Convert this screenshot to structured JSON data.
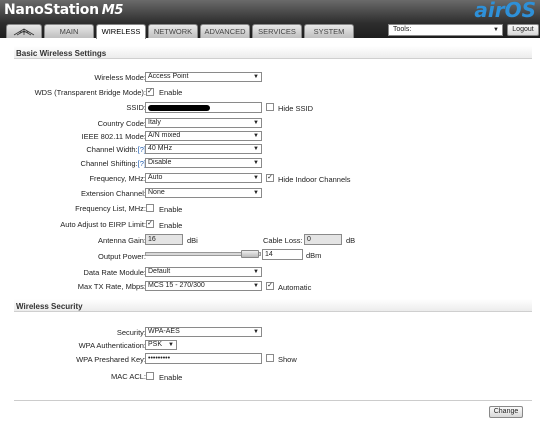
{
  "brand": {
    "name": "NanoStation",
    "model": "M5",
    "os_logo": "airOS"
  },
  "tabs": [
    {
      "icon": "ubnt-logo-icon"
    },
    {
      "label": "MAIN"
    },
    {
      "label": "WIRELESS"
    },
    {
      "label": "NETWORK"
    },
    {
      "label": "ADVANCED"
    },
    {
      "label": "SERVICES"
    },
    {
      "label": "SYSTEM"
    }
  ],
  "tools": {
    "label": "Tools:"
  },
  "logout_label": "Logout",
  "basic": {
    "title": "Basic Wireless Settings",
    "wireless_mode": {
      "label": "Wireless Mode:",
      "value": "Access Point"
    },
    "wds": {
      "label": "WDS (Transparent Bridge Mode):",
      "option": "Enable",
      "checked": true
    },
    "ssid": {
      "label": "SSID:",
      "hide_label": "Hide SSID"
    },
    "country": {
      "label": "Country Code:",
      "value": "Italy"
    },
    "ieee": {
      "label": "IEEE 802.11 Mode:",
      "value": "A/N mixed"
    },
    "channel_width": {
      "label": "Channel Width:",
      "help": "[?]",
      "value": "40 MHz"
    },
    "channel_shifting": {
      "label": "Channel Shifting:",
      "help": "[?]",
      "value": "Disable"
    },
    "frequency": {
      "label": "Frequency, MHz:",
      "value": "Auto",
      "hide_indoor": "Hide Indoor Channels",
      "hide_indoor_checked": true
    },
    "extension": {
      "label": "Extension Channel:",
      "value": "None"
    },
    "freq_list": {
      "label": "Frequency List, MHz:",
      "option": "Enable"
    },
    "auto_eirp": {
      "label": "Auto Adjust to EIRP Limit:",
      "option": "Enable",
      "checked": true
    },
    "antenna_gain": {
      "label": "Antenna Gain:",
      "value": "16",
      "unit": "dBi"
    },
    "cable_loss": {
      "label": "Cable Loss:",
      "value": "0",
      "unit": "dB"
    },
    "output_power": {
      "label": "Output Power:",
      "value": "14",
      "unit": "dBm"
    },
    "data_rate": {
      "label": "Data Rate Module:",
      "value": "Default"
    },
    "max_tx": {
      "label": "Max TX Rate, Mbps:",
      "value": "MCS 15 - 270/300",
      "auto_label": "Automatic",
      "auto_checked": true
    }
  },
  "security": {
    "title": "Wireless Security",
    "security": {
      "label": "Security:",
      "value": "WPA-AES"
    },
    "wpa_auth": {
      "label": "WPA Authentication:",
      "value": "PSK"
    },
    "psk": {
      "label": "WPA Preshared Key:",
      "value": "•••••••••",
      "show_label": "Show"
    },
    "mac_acl": {
      "label": "MAC ACL:",
      "option": "Enable"
    }
  },
  "change_label": "Change"
}
